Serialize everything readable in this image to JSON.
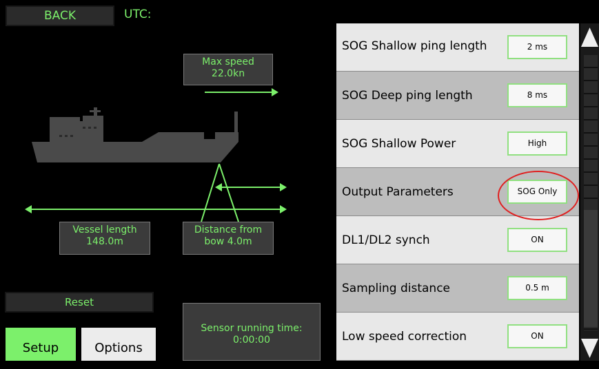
{
  "header": {
    "back_label": "BACK",
    "utc_label": "UTC:"
  },
  "diagram": {
    "max_speed_title": "Max speed",
    "max_speed_value": "22.0kn",
    "vessel_length_title": "Vessel length",
    "vessel_length_value": "148.0m",
    "distance_title": "Distance from",
    "distance_value": "bow 4.0m",
    "accent_color": "#7CF06B",
    "ship_color": "#4a4a4a"
  },
  "controls": {
    "reset_label": "Reset",
    "setup_tab": "Setup",
    "options_tab": "Options",
    "running_time_title": "Sensor running time:",
    "running_time_value": "0:00:00"
  },
  "settings": [
    {
      "label": "SOG Shallow ping length",
      "value": "2 ms"
    },
    {
      "label": "SOG Deep ping length",
      "value": "8 ms"
    },
    {
      "label": "SOG Shallow Power",
      "value": "High"
    },
    {
      "label": "Output Parameters",
      "value": "SOG Only"
    },
    {
      "label": "DL1/DL2 synch",
      "value": "ON"
    },
    {
      "label": "Sampling distance",
      "value": "0.5 m"
    },
    {
      "label": "Low speed correction",
      "value": "ON"
    }
  ],
  "highlight_color": "#e02020"
}
